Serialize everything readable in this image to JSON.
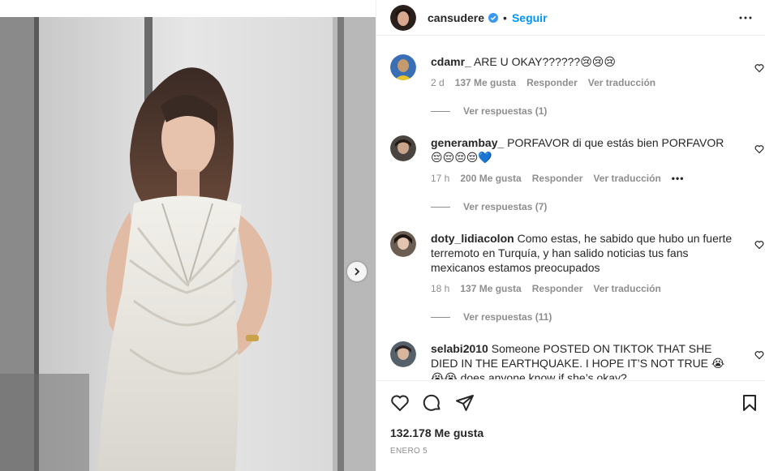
{
  "post": {
    "username": "cansudere",
    "dot": "•",
    "follow_label": "Seguir",
    "likes": "132.178 Me gusta",
    "date": "ENERO 5"
  },
  "colors": {
    "accent": "#0095f6",
    "verified": "#3897f0",
    "muted": "#8e8e8e"
  },
  "comments": [
    {
      "user": "cdamr_",
      "text": "ARE U OKAY??????😢😢😢",
      "age": "2 d",
      "likes": "137 Me gusta",
      "reply": "Responder",
      "translate": "Ver traducción",
      "replies": "Ver respuestas (1)"
    },
    {
      "user": "generambay_",
      "text": "PORFAVOR di que estás bien PORFAVOR 😔😔😔😔💙",
      "age": "17 h",
      "likes": "200 Me gusta",
      "reply": "Responder",
      "translate": "Ver traducción",
      "more": "•••",
      "replies": "Ver respuestas (7)"
    },
    {
      "user": "doty_lidiacolon",
      "text": "Como estas, he sabido que hubo un fuerte terremoto en Turquía, y han salido noticias tus fans mexicanos estamos preocupados",
      "age": "18 h",
      "likes": "137 Me gusta",
      "reply": "Responder",
      "translate": "Ver traducción",
      "replies": "Ver respuestas (11)"
    },
    {
      "user": "selabi2010",
      "text": "Someone POSTED ON TIKTOK THAT SHE DIED IN THE EARTHQUAKE. I HOPE IT’S NOT TRUE 😭😭😭 does anyone know if she’s okay?"
    }
  ],
  "icons": [
    "verified-badge-icon",
    "more-options-icon",
    "heart-icon",
    "comment-icon",
    "share-icon",
    "bookmark-icon",
    "chevron-right-icon"
  ]
}
